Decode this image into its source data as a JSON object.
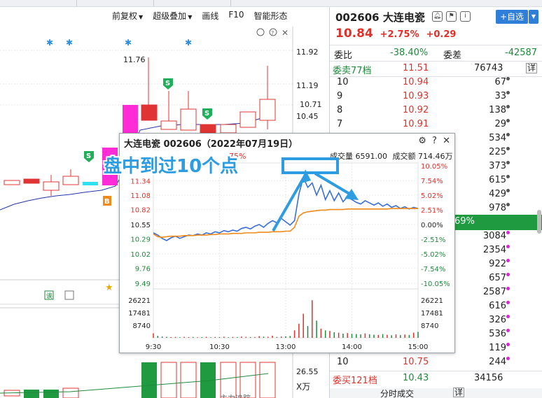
{
  "toolbar": {
    "items": [
      "前复权",
      "超级叠加",
      "画线",
      "F10",
      "智能形态"
    ]
  },
  "main": {
    "price_labels": [
      "11.92",
      "11.19",
      "10.71",
      "10.45",
      "11.76"
    ],
    "volume_labels": [
      "26.55",
      "X万"
    ],
    "bottom_label": "主力追踪",
    "marker_s": "S",
    "marker_b": "B"
  },
  "stock": {
    "code_name": "002606 大连电瓷",
    "price": "10.84",
    "change_pct": "+2.75%",
    "change": "+0.29",
    "add_watch": "+自选"
  },
  "quote": {
    "weibi_label": "委比",
    "weibi_value": "-38.40%",
    "weicha_label": "委差",
    "weicha_value": "-42587",
    "sell_label": "委卖77档",
    "sell_price": "11.51",
    "sell_vol": "76743",
    "detail": "详",
    "sell_rows": [
      {
        "lvl": "10",
        "price": "10.94",
        "vol": "67"
      },
      {
        "lvl": "9",
        "price": "10.93",
        "vol": "33"
      },
      {
        "lvl": "8",
        "price": "10.92",
        "vol": "138"
      },
      {
        "lvl": "7",
        "price": "10.91",
        "vol": "29"
      },
      {
        "lvl": "",
        "price": "",
        "vol": "534"
      },
      {
        "lvl": "",
        "price": "",
        "vol": "225"
      },
      {
        "lvl": "",
        "price": "",
        "vol": "373"
      },
      {
        "lvl": "",
        "price": "",
        "vol": "615"
      },
      {
        "lvl": "",
        "price": "",
        "vol": "429"
      },
      {
        "lvl": "",
        "price": "",
        "vol": "978"
      }
    ],
    "mid_pct": "69%",
    "buy_rows": [
      {
        "lvl": "",
        "price": "",
        "vol": "3084"
      },
      {
        "lvl": "",
        "price": "",
        "vol": "2354"
      },
      {
        "lvl": "",
        "price": "",
        "vol": "922"
      },
      {
        "lvl": "",
        "price": "",
        "vol": "657"
      },
      {
        "lvl": "",
        "price": "",
        "vol": "2587"
      },
      {
        "lvl": "",
        "price": "",
        "vol": "616"
      },
      {
        "lvl": "",
        "price": "",
        "vol": "326"
      },
      {
        "lvl": "",
        "price": "",
        "vol": "536"
      },
      {
        "lvl": "",
        "price": "",
        "vol": "119"
      },
      {
        "lvl": "10",
        "price": "10.75",
        "vol": "244"
      }
    ],
    "buy_label": "委买121档",
    "buy_price": "10.43",
    "buy_vol": "34156",
    "tab_label": "分时成交",
    "tab_detail": "详"
  },
  "popup": {
    "title": "大连电瓷 002606（2022年07月19日）",
    "vol_label": "成交量",
    "vol_value": "6591.00",
    "amt_label": "成交额",
    "amt_value": "714.46万",
    "partial_pct": "75%",
    "annotation": "盘中到过10个点"
  },
  "chart_data": {
    "type": "line",
    "title": "大连电瓷 002606（2022年07月19日）",
    "prev_close": 10.55,
    "x_ticks": [
      "9:30",
      "10:30",
      "13:00",
      "14:00",
      "15:00"
    ],
    "price_ticks": [
      11.34,
      11.08,
      10.82,
      10.55,
      10.29,
      10.02,
      9.76,
      9.49
    ],
    "pct_ticks": [
      "10.05%",
      "7.54%",
      "5.02%",
      "2.51%",
      "0.00%",
      "-2.51%",
      "-5.02%",
      "-7.54%",
      "-10.05%"
    ],
    "volume_ticks": [
      26221,
      17481,
      8740
    ],
    "ylim": [
      9.49,
      11.61
    ],
    "series": [
      {
        "name": "price",
        "color": "#3a6fd8",
        "values": [
          10.4,
          10.36,
          10.3,
          10.26,
          10.31,
          10.34,
          10.3,
          10.33,
          10.36,
          10.35,
          10.38,
          10.36,
          10.4,
          10.38,
          10.42,
          10.4,
          10.44,
          10.42,
          10.45,
          10.43,
          10.48,
          10.5,
          10.47,
          10.52,
          10.55,
          10.5,
          10.57,
          10.62,
          10.58,
          10.66,
          10.6,
          10.54,
          10.62,
          11.1,
          11.4,
          11.22,
          11.3,
          11.08,
          11.26,
          11.0,
          11.16,
          10.98,
          11.12,
          10.96,
          11.05,
          11.0,
          10.95,
          10.92,
          10.98,
          10.94,
          10.9,
          10.94,
          10.88,
          10.92,
          10.86,
          10.89,
          10.84,
          10.87,
          10.83,
          10.86,
          10.84
        ]
      },
      {
        "name": "avg",
        "color": "#f08a1a",
        "values": [
          10.38,
          10.33,
          10.32,
          10.33,
          10.34,
          10.34,
          10.34,
          10.35,
          10.35,
          10.35,
          10.36,
          10.36,
          10.36,
          10.37,
          10.37,
          10.38,
          10.38,
          10.38,
          10.39,
          10.39,
          10.39,
          10.4,
          10.4,
          10.4,
          10.41,
          10.41,
          10.41,
          10.42,
          10.42,
          10.42,
          10.43,
          10.43,
          10.5,
          10.7,
          10.76,
          10.78,
          10.79,
          10.8,
          10.81,
          10.81,
          10.82,
          10.82,
          10.82,
          10.82,
          10.83,
          10.83,
          10.83,
          10.83,
          10.83,
          10.83,
          10.83,
          10.83,
          10.83,
          10.83,
          10.84,
          10.84,
          10.84,
          10.84,
          10.84,
          10.84,
          10.84
        ]
      }
    ],
    "volume": [
      3200,
      1400,
      900,
      700,
      500,
      600,
      400,
      700,
      500,
      600,
      400,
      500,
      700,
      400,
      600,
      500,
      800,
      400,
      600,
      500,
      900,
      700,
      500,
      600,
      1200,
      800,
      700,
      1500,
      600,
      900,
      1100,
      1300,
      5200,
      9800,
      16800,
      8200,
      26221,
      12000,
      6400,
      5200,
      4800,
      3900,
      3600,
      2900,
      3300,
      2800,
      2600,
      2400,
      3100,
      2500,
      2200,
      2000,
      2600,
      2100,
      1800,
      2400,
      1900,
      2300,
      2000,
      3600,
      4200
    ]
  }
}
